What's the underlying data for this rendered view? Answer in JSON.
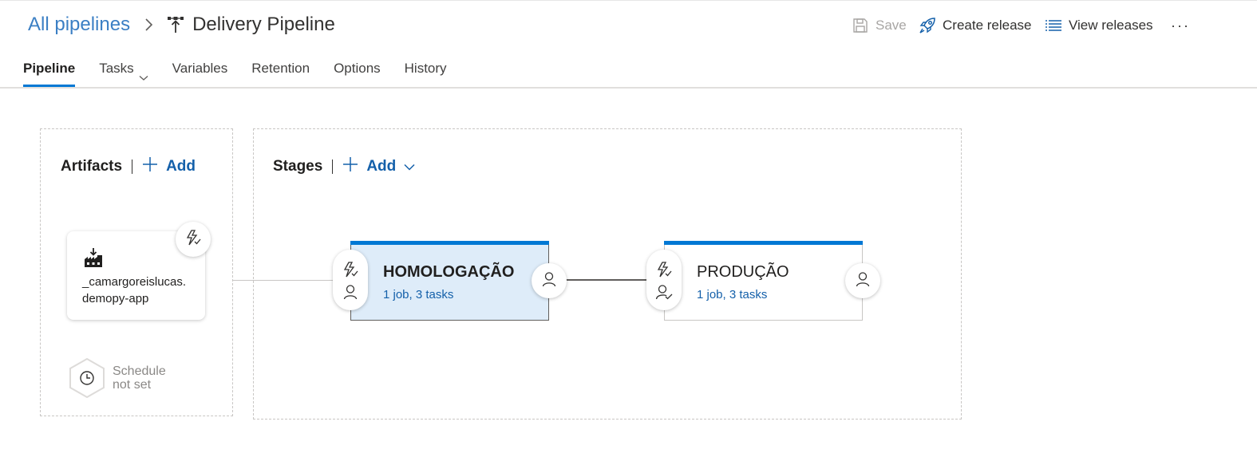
{
  "header": {
    "breadcrumb_root": "All pipelines",
    "title": "Delivery Pipeline"
  },
  "toolbar": {
    "save_label": "Save",
    "create_release_label": "Create release",
    "view_releases_label": "View releases",
    "more_label": "···"
  },
  "tabs": [
    {
      "label": "Pipeline",
      "active": true
    },
    {
      "label": "Tasks",
      "has_dropdown": true
    },
    {
      "label": "Variables"
    },
    {
      "label": "Retention"
    },
    {
      "label": "Options"
    },
    {
      "label": "History"
    }
  ],
  "artifacts": {
    "title": "Artifacts",
    "add_label": "Add",
    "card": {
      "name_line1": "_camargoreislucas.",
      "name_line2": "demopy-app"
    },
    "schedule": {
      "line1": "Schedule",
      "line2": "not set"
    }
  },
  "stages": {
    "title": "Stages",
    "add_label": "Add",
    "items": [
      {
        "name": "HOMOLOGAÇÃO",
        "info": "1 job, 3 tasks",
        "selected": true
      },
      {
        "name": "PRODUÇÃO",
        "info": "1 job, 3 tasks",
        "selected": false
      }
    ]
  },
  "colors": {
    "accent": "#0078d4",
    "link": "#1460aa",
    "selected_stage_bg": "#deecf9"
  }
}
